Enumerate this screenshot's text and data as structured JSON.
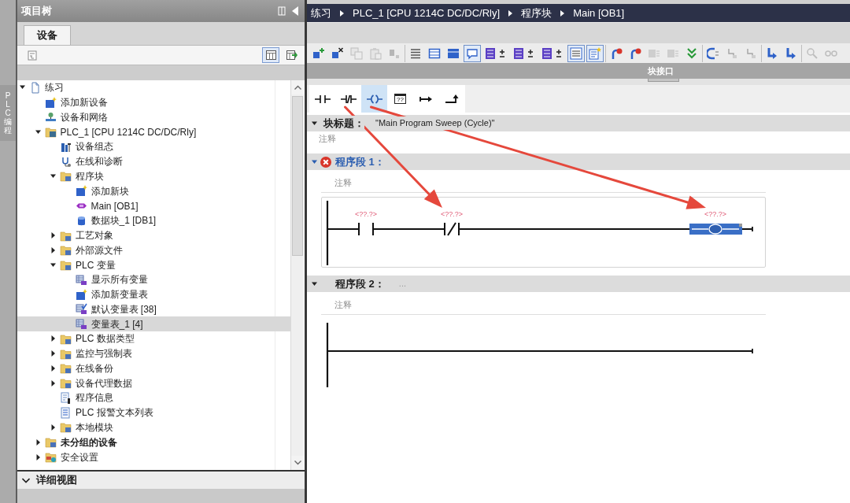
{
  "side_strip": {
    "tab": "PLC 编程"
  },
  "project_tree": {
    "title": "项目树",
    "tabs": [
      {
        "label": "设备",
        "selected": true
      }
    ],
    "toolbar": {
      "left": [
        {
          "kind": "properties",
          "selected": false
        }
      ],
      "right": [
        {
          "kind": "table-view",
          "selected": true
        },
        {
          "kind": "export",
          "selected": false
        }
      ]
    },
    "items": [
      {
        "label": "练习",
        "kind": "project",
        "expanded": true,
        "selected": false,
        "children": [
          {
            "label": "添加新设备",
            "kind": "add",
            "selected": false
          },
          {
            "label": "设备和网络",
            "kind": "network",
            "selected": false
          },
          {
            "label": "PLC_1 [CPU 1214C DC/DC/Rly]",
            "kind": "cpu",
            "expanded": true,
            "selected": false,
            "children": [
              {
                "label": "设备组态",
                "kind": "config",
                "selected": false
              },
              {
                "label": "在线和诊断",
                "kind": "diagnostics",
                "selected": false
              },
              {
                "label": "程序块",
                "kind": "folder",
                "expanded": true,
                "selected": false,
                "children": [
                  {
                    "label": "添加新块",
                    "kind": "add",
                    "selected": false
                  },
                  {
                    "label": "Main [OB1]",
                    "kind": "ob",
                    "selected": false
                  },
                  {
                    "label": "数据块_1 [DB1]",
                    "kind": "db",
                    "selected": false
                  }
                ]
              },
              {
                "label": "工艺对象",
                "kind": "folder",
                "expanded": false,
                "selected": false
              },
              {
                "label": "外部源文件",
                "kind": "folder",
                "expanded": false,
                "selected": false
              },
              {
                "label": "PLC 变量",
                "kind": "folder",
                "expanded": true,
                "selected": false,
                "children": [
                  {
                    "label": "显示所有变量",
                    "kind": "tags",
                    "selected": false
                  },
                  {
                    "label": "添加新变量表",
                    "kind": "add",
                    "selected": false
                  },
                  {
                    "label": "默认变量表 [38]",
                    "kind": "tag-table",
                    "selected": false
                  },
                  {
                    "label": "变量表_1 [4]",
                    "kind": "tags",
                    "selected": true
                  }
                ]
              },
              {
                "label": "PLC 数据类型",
                "kind": "folder",
                "expanded": false,
                "selected": false
              },
              {
                "label": "监控与强制表",
                "kind": "folder",
                "expanded": false,
                "selected": false
              },
              {
                "label": "在线备份",
                "kind": "folder",
                "expanded": false,
                "selected": false
              },
              {
                "label": "设备代理数据",
                "kind": "folder",
                "expanded": false,
                "selected": false
              },
              {
                "label": "程序信息",
                "kind": "info",
                "selected": false
              },
              {
                "label": "PLC 报警文本列表",
                "kind": "text-list",
                "selected": false
              },
              {
                "label": "本地模块",
                "kind": "folder",
                "expanded": false,
                "selected": false
              }
            ]
          },
          {
            "label": "未分组的设备",
            "kind": "folder",
            "expanded": false,
            "selected": false,
            "bold": true
          },
          {
            "label": "安全设置",
            "kind": "security",
            "expanded": false,
            "selected": false
          }
        ]
      }
    ]
  },
  "detail_view": {
    "title": "详细视图",
    "expanded": false
  },
  "breadcrumb": [
    "练习",
    "PLC_1 [CPU 1214C DC/DC/Rly]",
    "程序块",
    "Main [OB1]"
  ],
  "editor_toolbar": {
    "groups": [
      [
        {
          "kind": "network-insert",
          "selected": false,
          "disabled": false
        },
        {
          "kind": "network-delete",
          "selected": false,
          "disabled": false
        },
        {
          "kind": "copy",
          "selected": false,
          "disabled": true
        },
        {
          "kind": "paste",
          "selected": false,
          "disabled": true
        },
        {
          "kind": "tool",
          "selected": false,
          "disabled": true
        }
      ],
      [
        {
          "kind": "lines",
          "selected": false,
          "disabled": false
        },
        {
          "kind": "window",
          "selected": false,
          "disabled": false
        },
        {
          "kind": "window-filled",
          "selected": false,
          "disabled": false
        },
        {
          "kind": "comment",
          "selected": true,
          "disabled": false
        },
        {
          "kind": "plus-minus",
          "selected": false,
          "disabled": false
        },
        {
          "kind": "plus-minus",
          "selected": false,
          "disabled": false
        },
        {
          "kind": "plus-minus",
          "selected": false,
          "disabled": false
        },
        {
          "kind": "list",
          "selected": true,
          "disabled": false
        },
        {
          "kind": "note",
          "selected": true,
          "disabled": false
        }
      ],
      [
        {
          "kind": "jump",
          "selected": false,
          "disabled": false
        },
        {
          "kind": "jump",
          "selected": false,
          "disabled": false
        },
        {
          "kind": "monitor",
          "selected": false,
          "disabled": true
        },
        {
          "kind": "monitor",
          "selected": false,
          "disabled": true
        },
        {
          "kind": "download",
          "selected": false,
          "disabled": false
        }
      ],
      [
        {
          "kind": "call",
          "selected": false,
          "disabled": false
        },
        {
          "kind": "step",
          "selected": false,
          "disabled": true
        },
        {
          "kind": "step",
          "selected": false,
          "disabled": true
        }
      ],
      [
        {
          "kind": "corner-arrow",
          "selected": false,
          "disabled": false
        },
        {
          "kind": "corner-arrow",
          "selected": false,
          "disabled": false
        }
      ],
      [
        {
          "kind": "search",
          "selected": false,
          "disabled": true
        },
        {
          "kind": "glasses",
          "selected": false,
          "disabled": true
        }
      ]
    ]
  },
  "interface_bar": {
    "title": "块接口"
  },
  "instruction_toolbar": [
    {
      "kind": "no-contact",
      "selected": false
    },
    {
      "kind": "nc-contact",
      "selected": false
    },
    {
      "kind": "coil",
      "selected": true
    },
    {
      "kind": "empty-box",
      "text": "??",
      "selected": false
    },
    {
      "kind": "open-branch",
      "selected": false
    },
    {
      "kind": "close-branch",
      "selected": false
    }
  ],
  "block_title": {
    "label": "块标题：",
    "value": "\"Main Program Sweep (Cycle)\"",
    "expanded": true,
    "comment": "注释"
  },
  "networks": [
    {
      "title": "程序段 1：",
      "selected": true,
      "error": true,
      "expanded": true,
      "comment": "注释",
      "elements": [
        {
          "kind": "no-contact",
          "operand": "<??.?>",
          "selected": false,
          "annotated": false
        },
        {
          "kind": "nc-contact",
          "operand": "<??.?>",
          "selected": false,
          "annotated": true
        },
        {
          "kind": "coil",
          "operand": "<??.?>",
          "selected": true,
          "annotated": true
        }
      ]
    },
    {
      "title": "程序段 2：",
      "title_extra": "...",
      "selected": false,
      "error": false,
      "expanded": true,
      "comment": "注释"
    }
  ]
}
